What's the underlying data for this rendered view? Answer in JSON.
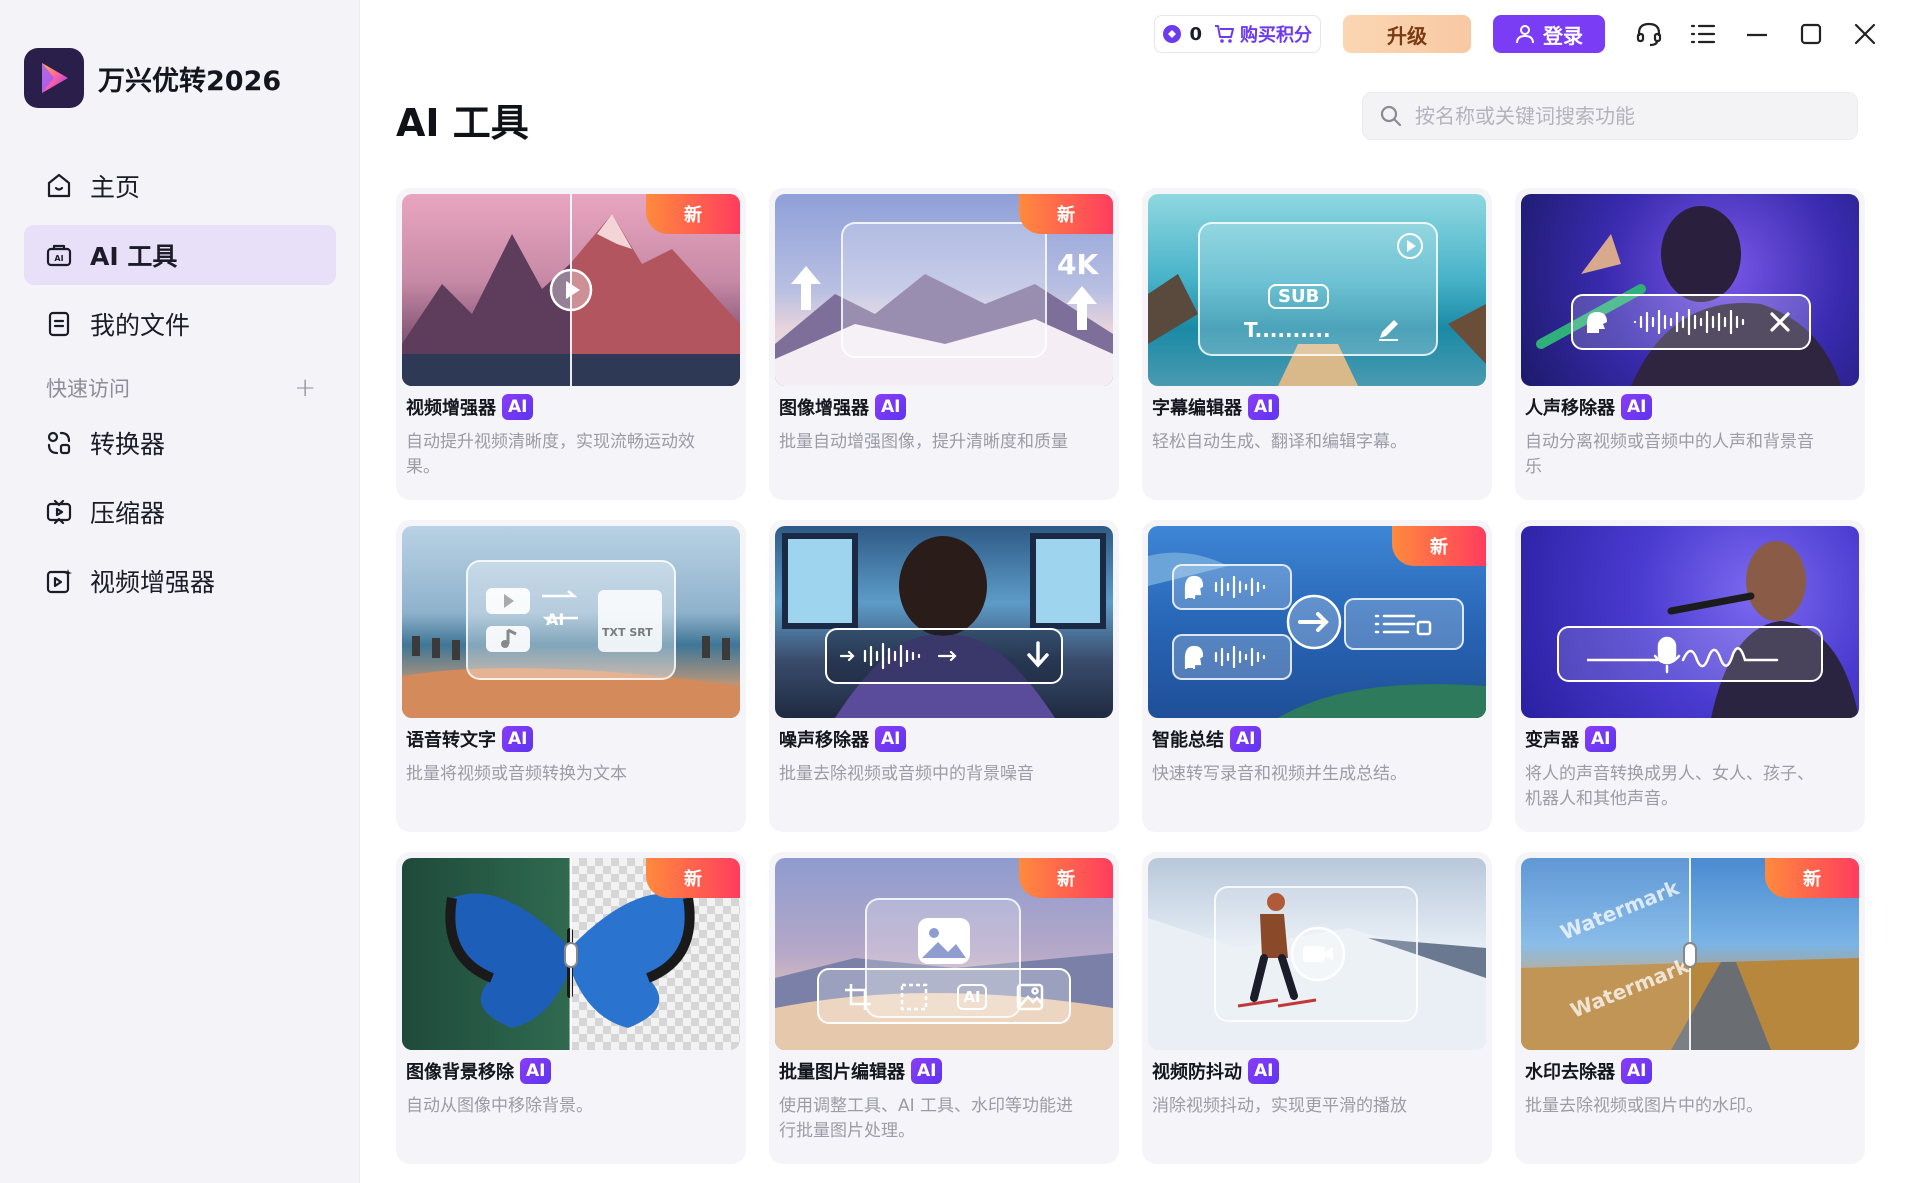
{
  "app": {
    "name": "万兴优转2026"
  },
  "sidebar": {
    "nav": [
      {
        "label": "主页",
        "icon": "home-icon"
      },
      {
        "label": "AI 工具",
        "icon": "ai-toolbox-icon",
        "active": true
      },
      {
        "label": "我的文件",
        "icon": "file-icon"
      }
    ],
    "quick_access_label": "快速访问",
    "quick_access_add": "+",
    "quick": [
      {
        "label": "转换器",
        "icon": "converter-icon"
      },
      {
        "label": "压缩器",
        "icon": "compressor-icon"
      },
      {
        "label": "视频增强器",
        "icon": "video-enhance-icon"
      }
    ]
  },
  "topbar": {
    "points": "0",
    "buy_points": "购买积分",
    "upgrade": "升级",
    "login": "登录"
  },
  "main": {
    "title": "AI 工具",
    "search_placeholder": "按名称或关键词搜索功能",
    "new_label": "新",
    "ai_label": "AI",
    "tools": [
      {
        "name": "视频增强器",
        "desc": "自动提升视频清晰度，实现流畅运动效果。",
        "new": true
      },
      {
        "name": "图像增强器",
        "desc": "批量自动增强图像，提升清晰度和质量",
        "new": true,
        "overlay": "4K"
      },
      {
        "name": "字幕编辑器",
        "desc": "轻松自动生成、翻译和编辑字幕。",
        "new": false,
        "overlay": "SUB",
        "overlay2": "T.........."
      },
      {
        "name": "人声移除器",
        "desc": "自动分离视频或音频中的人声和背景音乐",
        "new": false
      },
      {
        "name": "语音转文字",
        "desc": "批量将视频或音频转换为文本",
        "new": false,
        "overlay": "AI",
        "overlay2": "TXT SRT"
      },
      {
        "name": "噪声移除器",
        "desc": "批量去除视频或音频中的背景噪音",
        "new": false
      },
      {
        "name": "智能总结",
        "desc": "快速转写录音和视频并生成总结。",
        "new": true
      },
      {
        "name": "变声器",
        "desc": "将人的声音转换成男人、女人、孩子、机器人和其他声音。",
        "new": false
      },
      {
        "name": "图像背景移除",
        "desc": "自动从图像中移除背景。",
        "new": true
      },
      {
        "name": "批量图片编辑器",
        "desc": "使用调整工具、AI 工具、水印等功能进行批量图片处理。",
        "new": true,
        "overlay": "AI"
      },
      {
        "name": "视频防抖动",
        "desc": "消除视频抖动，实现更平滑的播放",
        "new": false
      },
      {
        "name": "水印去除器",
        "desc": "批量去除视频或图片中的水印。",
        "new": true,
        "overlay": "Watermark"
      }
    ]
  },
  "colors": {
    "accent": "#7b3cf5",
    "active_nav_bg": "#e8dff8",
    "new_badge_start": "#ff8a3d",
    "new_badge_end": "#ff3d5e"
  }
}
